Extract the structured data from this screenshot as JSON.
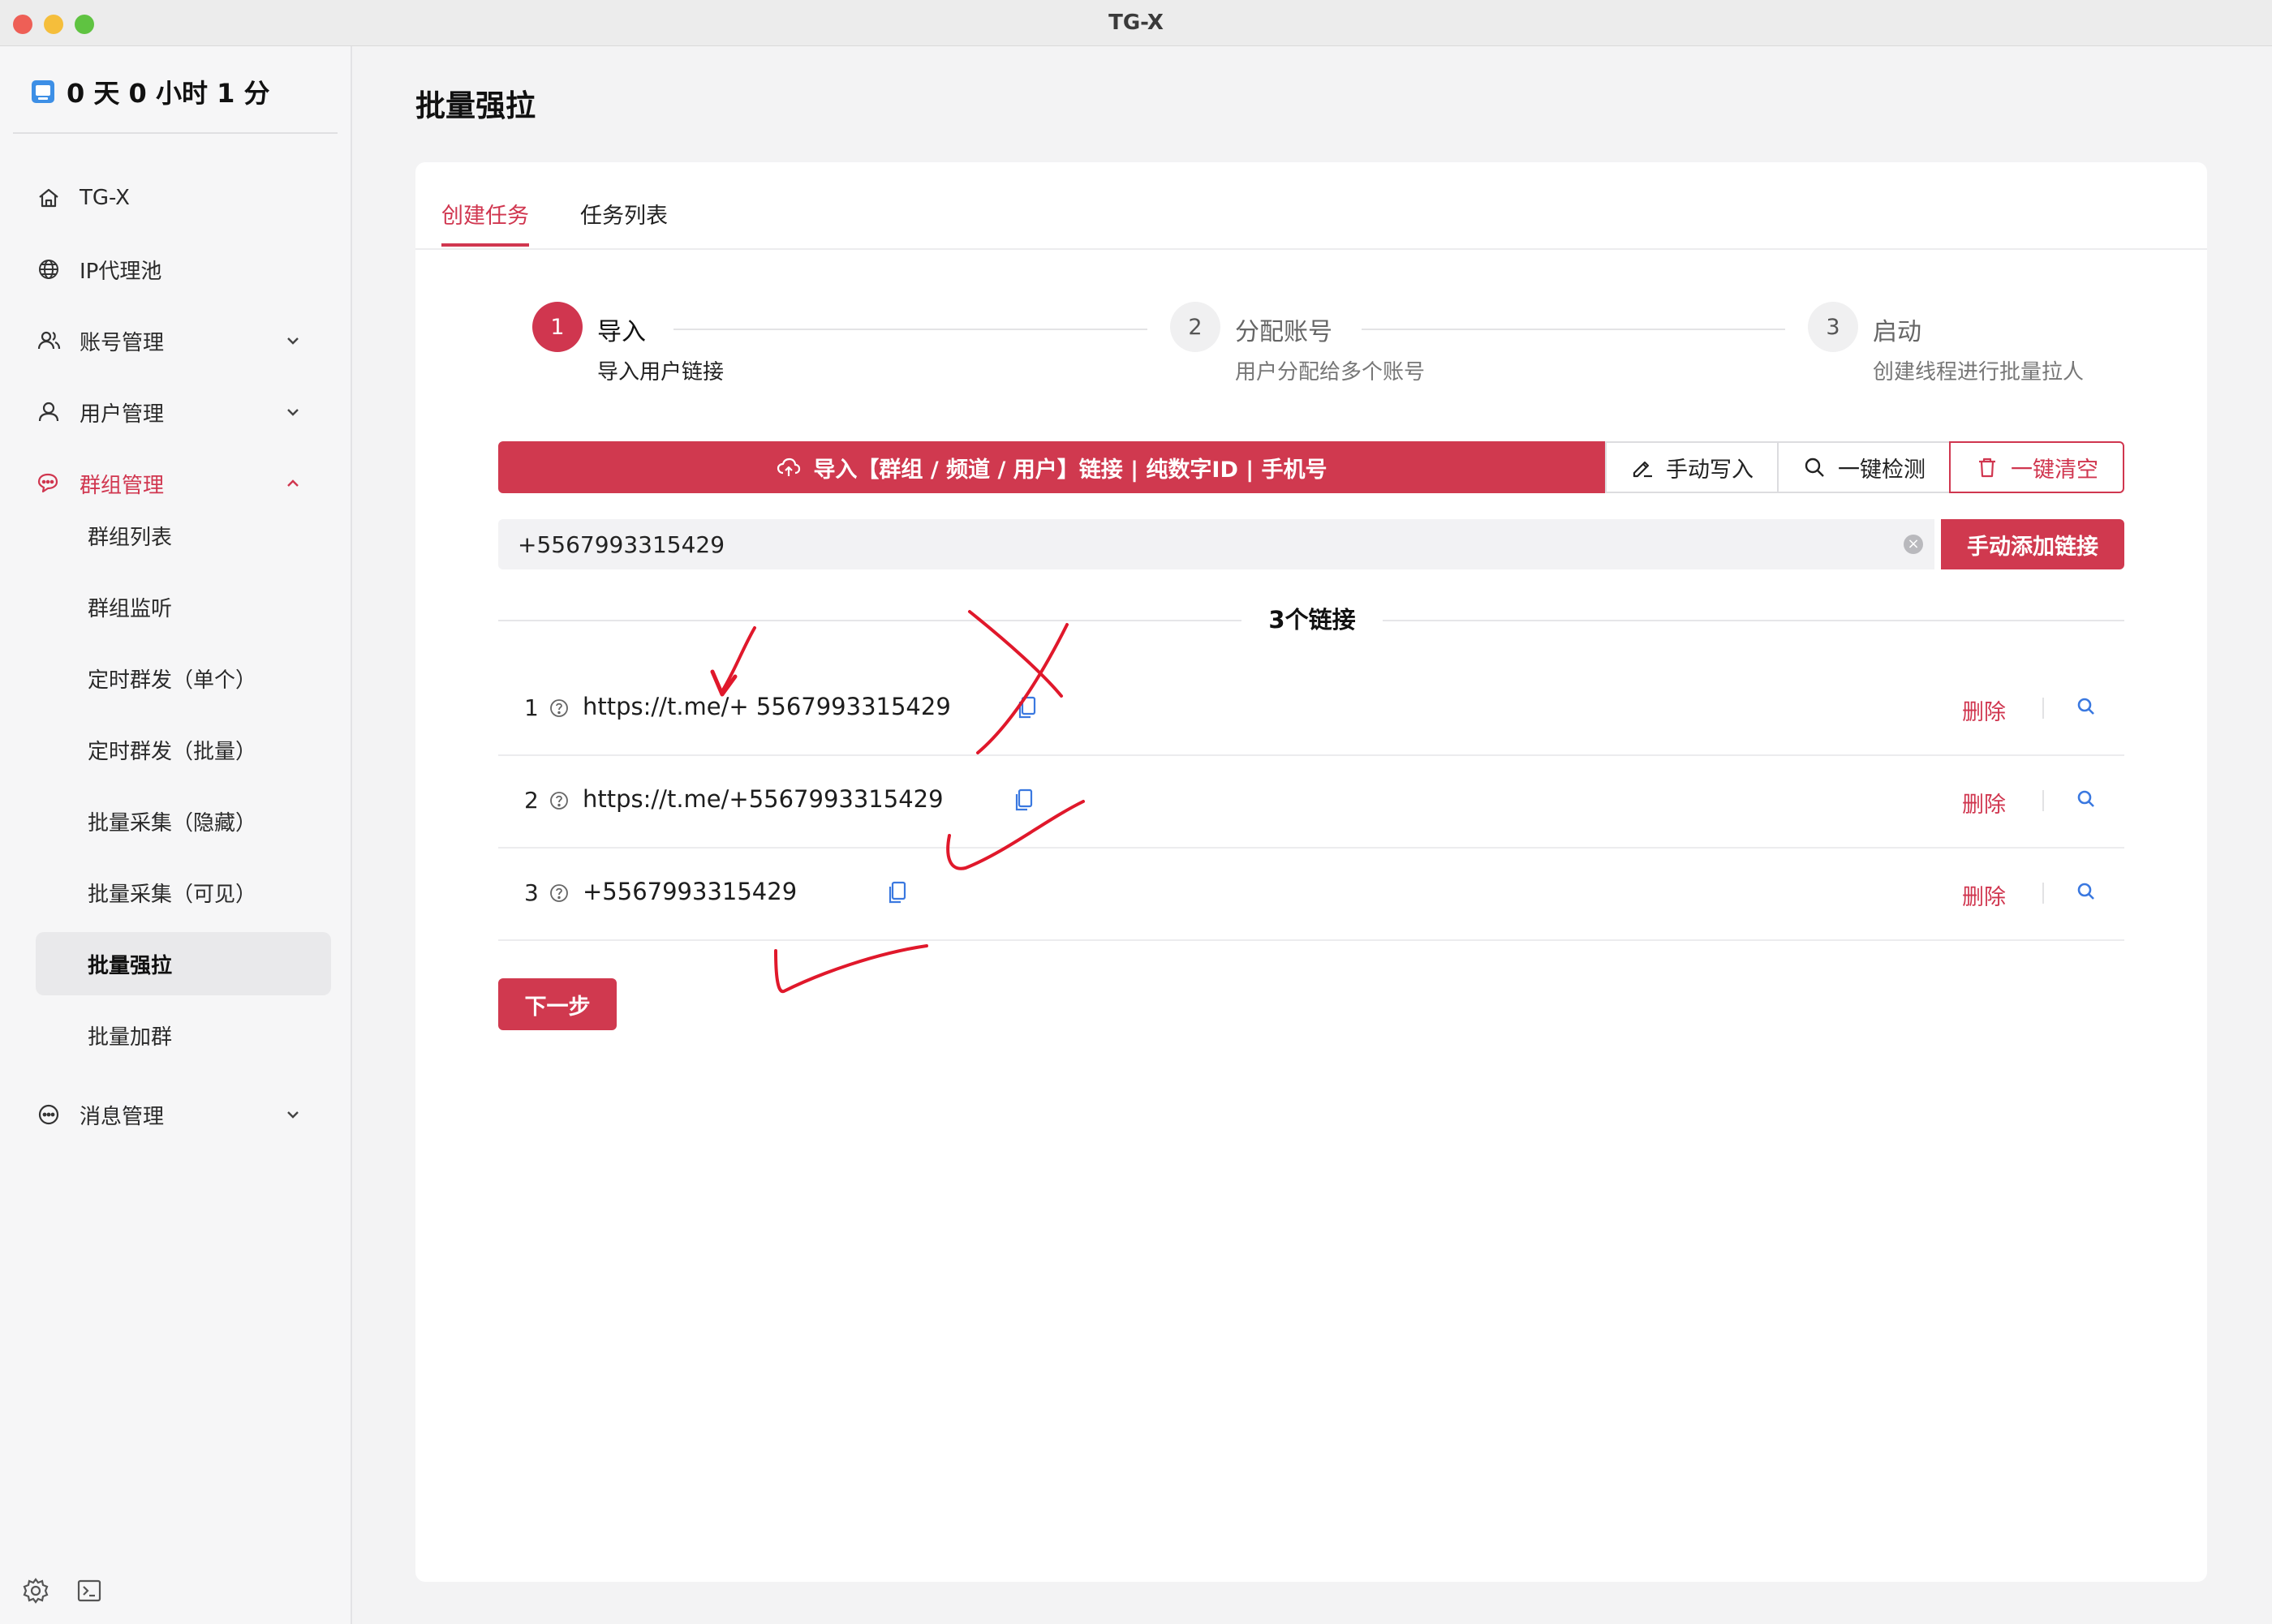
{
  "window": {
    "title": "TG-X"
  },
  "sidebar": {
    "uptime": "0 天 0 小时 1 分",
    "items": [
      {
        "label": "TG-X",
        "icon": "home-icon"
      },
      {
        "label": "IP代理池",
        "icon": "globe-icon"
      },
      {
        "label": "账号管理",
        "icon": "users-icon",
        "expanded": false
      },
      {
        "label": "用户管理",
        "icon": "user-icon",
        "expanded": false
      },
      {
        "label": "群组管理",
        "icon": "chat-group-icon",
        "expanded": true,
        "active": true
      },
      {
        "label": "消息管理",
        "icon": "message-icon",
        "expanded": false
      }
    ],
    "group_sub_items": [
      {
        "label": "群组列表"
      },
      {
        "label": "群组监听"
      },
      {
        "label": "定时群发（单个）"
      },
      {
        "label": "定时群发（批量）"
      },
      {
        "label": "批量采集（隐藏）"
      },
      {
        "label": "批量采集（可见）"
      },
      {
        "label": "批量强拉",
        "selected": true
      },
      {
        "label": "批量加群"
      }
    ],
    "bottom_icons": [
      "settings-icon",
      "terminal-icon"
    ]
  },
  "page": {
    "title": "批量强拉"
  },
  "tabs": [
    {
      "label": "创建任务",
      "active": true
    },
    {
      "label": "任务列表",
      "active": false
    }
  ],
  "steps": [
    {
      "number": "1",
      "title": "导入",
      "desc": "导入用户链接",
      "state": "current"
    },
    {
      "number": "2",
      "title": "分配账号",
      "desc": "用户分配给多个账号",
      "state": "waiting"
    },
    {
      "number": "3",
      "title": "启动",
      "desc": "创建线程进行批量拉人",
      "state": "waiting"
    }
  ],
  "toolbar": {
    "import_label": "导入【群组 / 频道 / 用户】链接 | 纯数字ID | 手机号",
    "manual_write_label": "手动写入",
    "check_label": "一键检测",
    "clear_label": "一键清空"
  },
  "link_input": {
    "value": "+5567993315429",
    "add_label": "手动添加链接"
  },
  "link_count": "3个链接",
  "links": [
    {
      "index": "1",
      "url": "https://t.me/+ 5567993315429",
      "delete_label": "删除"
    },
    {
      "index": "2",
      "url": "https://t.me/+5567993315429",
      "delete_label": "删除"
    },
    {
      "index": "3",
      "url": "+5567993315429",
      "delete_label": "删除"
    }
  ],
  "next_label": "下一步",
  "colors": {
    "accent": "#d0394f",
    "annotation": "#e0182b",
    "link_icon": "#3a78e0"
  }
}
